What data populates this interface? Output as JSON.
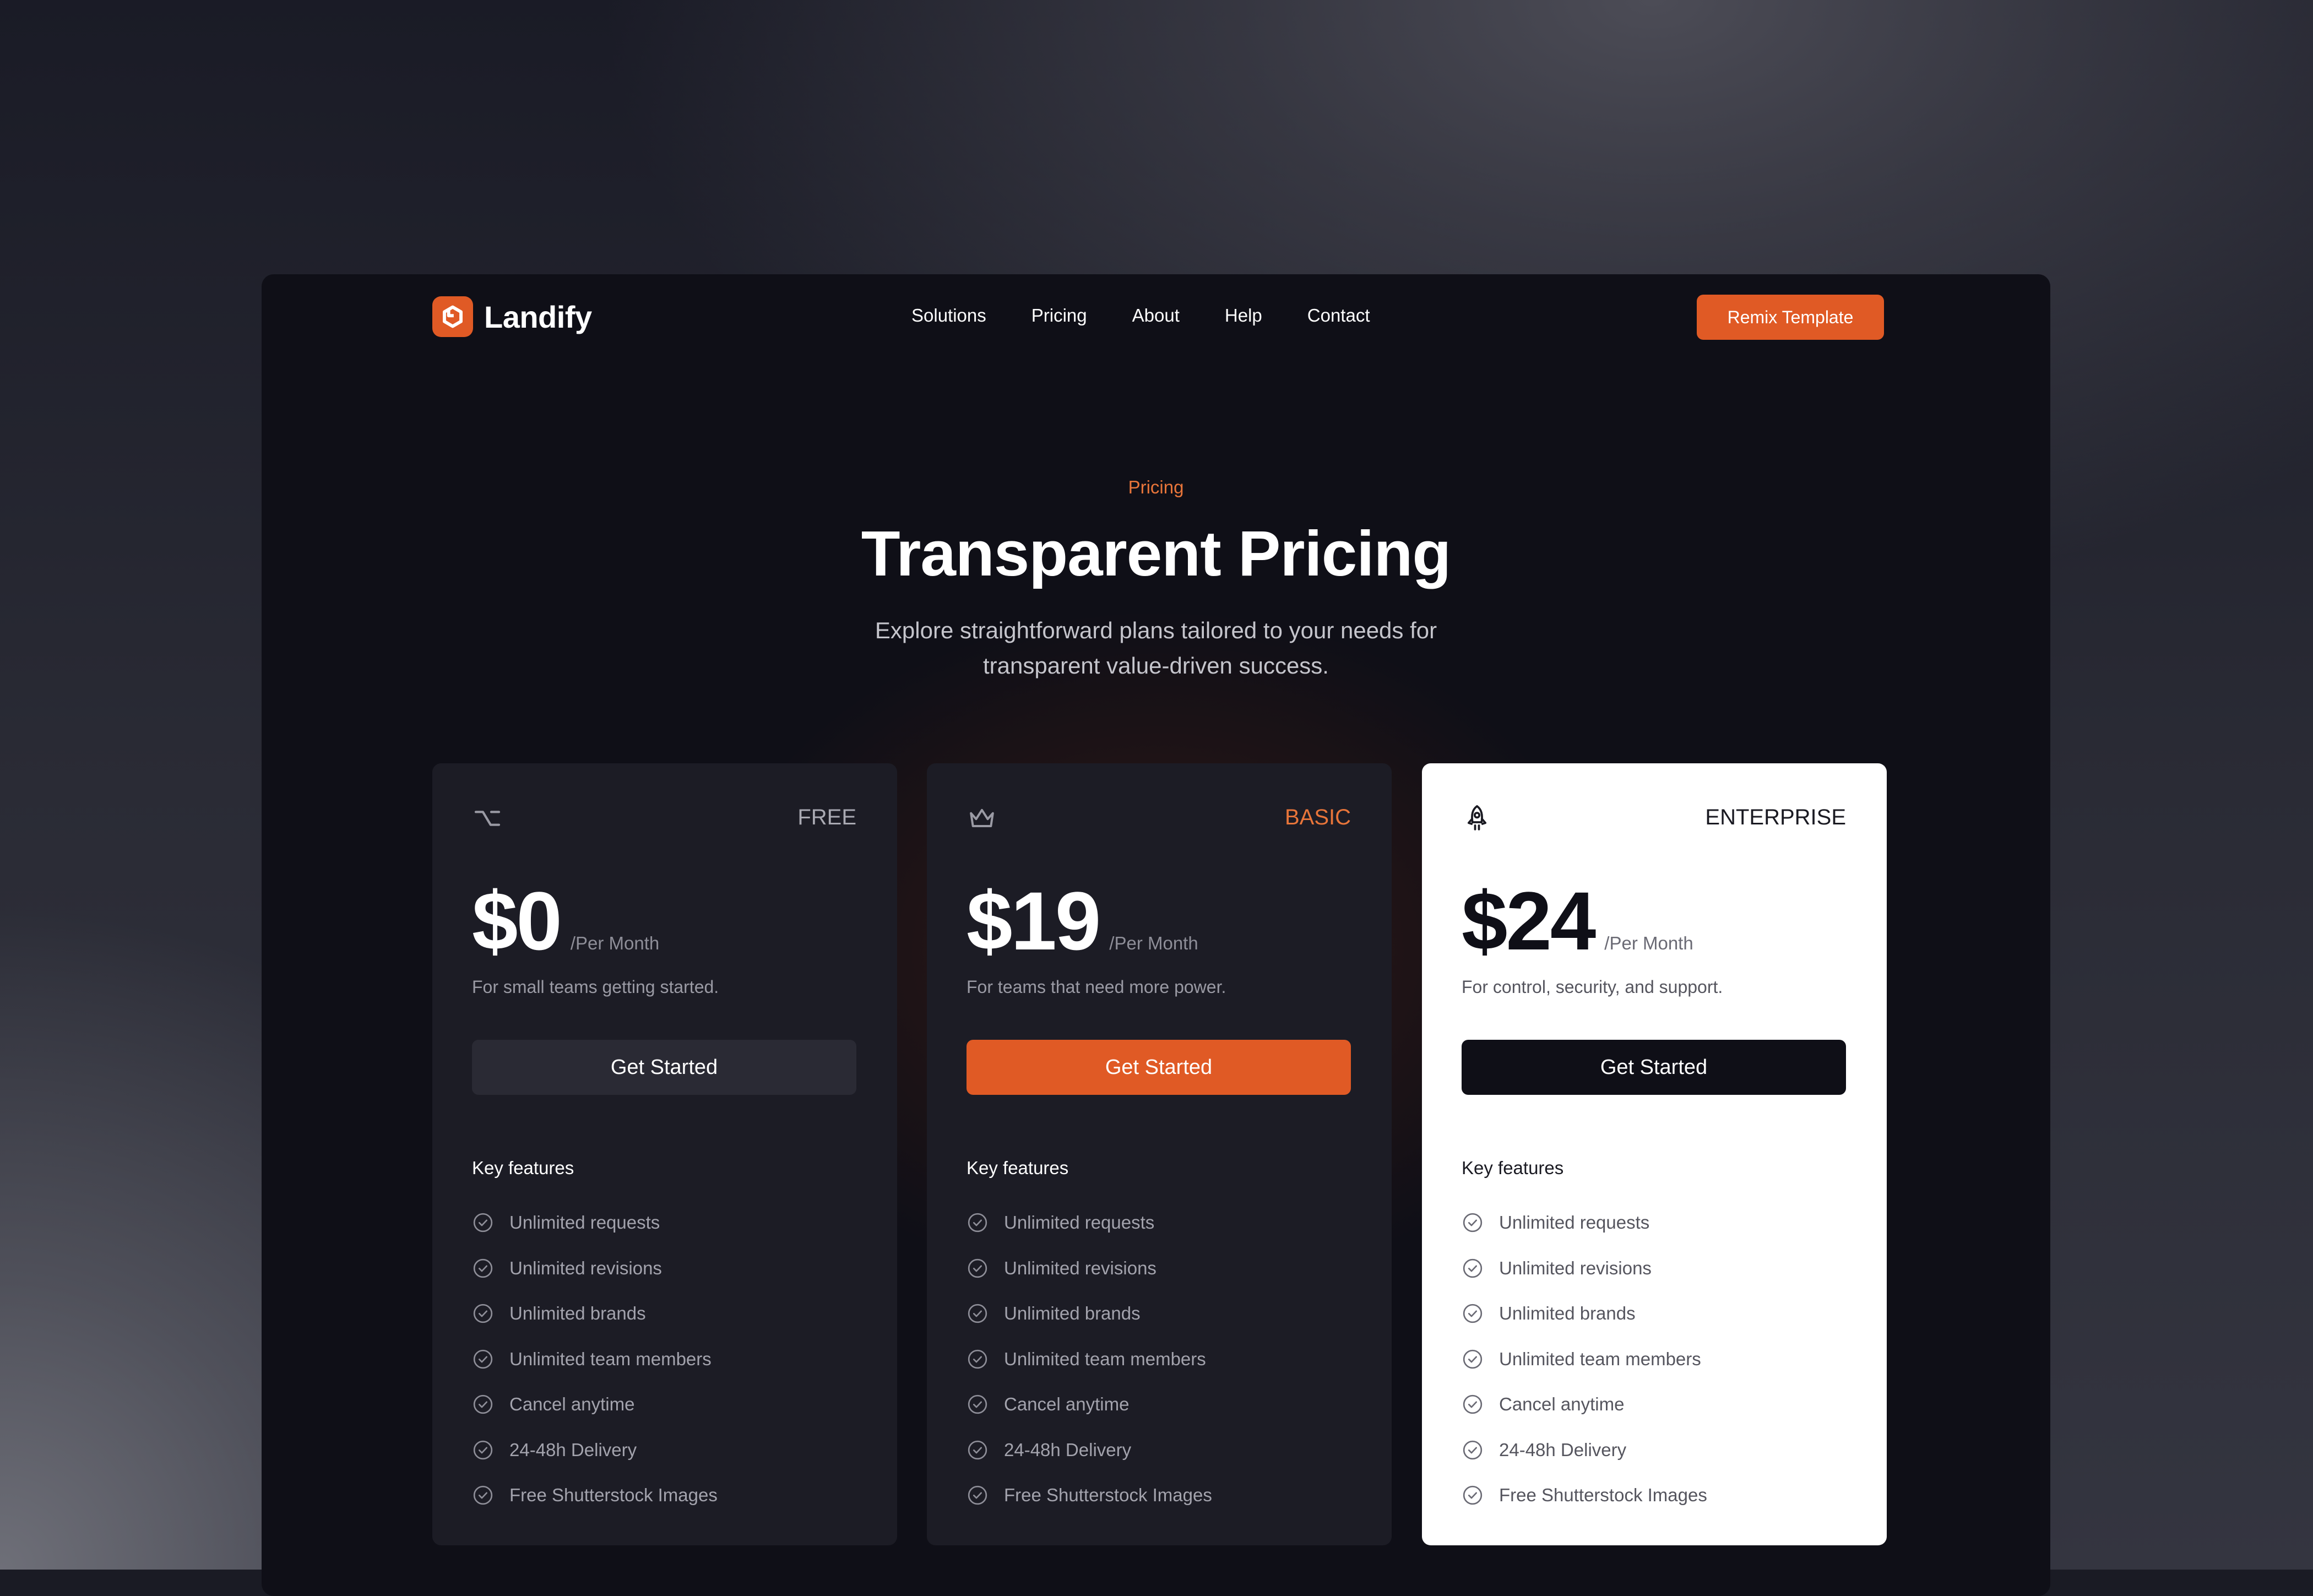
{
  "brand": {
    "name": "Landify",
    "accent": "#e05a25",
    "logo_icon": "landify-logo-icon"
  },
  "nav": {
    "links": [
      "Solutions",
      "Pricing",
      "About",
      "Help",
      "Contact"
    ],
    "cta_label": "Remix Template"
  },
  "hero": {
    "eyebrow": "Pricing",
    "title": "Transparent Pricing",
    "subtitle_line1": "Explore straightforward plans tailored to your needs for",
    "subtitle_line2": "transparent value-driven success."
  },
  "plans": [
    {
      "name": "FREE",
      "icon": "option-key-icon",
      "price": "$0",
      "period": "/Per Month",
      "description": "For small teams getting started.",
      "button_label": "Get Started",
      "features_title": "Key features",
      "features": [
        "Unlimited requests",
        "Unlimited revisions",
        "Unlimited brands",
        "Unlimited team members",
        "Cancel anytime",
        "24-48h Delivery",
        "Free Shutterstock Images"
      ]
    },
    {
      "name": "BASIC",
      "icon": "crown-icon",
      "price": "$19",
      "period": "/Per Month",
      "description": "For teams that need more power.",
      "button_label": "Get Started",
      "features_title": "Key features",
      "features": [
        "Unlimited requests",
        "Unlimited revisions",
        "Unlimited brands",
        "Unlimited team members",
        "Cancel anytime",
        "24-48h Delivery",
        "Free Shutterstock Images"
      ]
    },
    {
      "name": "ENTERPRISE",
      "icon": "rocket-icon",
      "price": "$24",
      "period": "/Per Month",
      "description": "For control, security, and support.",
      "button_label": "Get Started",
      "features_title": "Key features",
      "features": [
        "Unlimited requests",
        "Unlimited revisions",
        "Unlimited brands",
        "Unlimited team members",
        "Cancel anytime",
        "24-48h Delivery",
        "Free Shutterstock Images"
      ]
    }
  ]
}
